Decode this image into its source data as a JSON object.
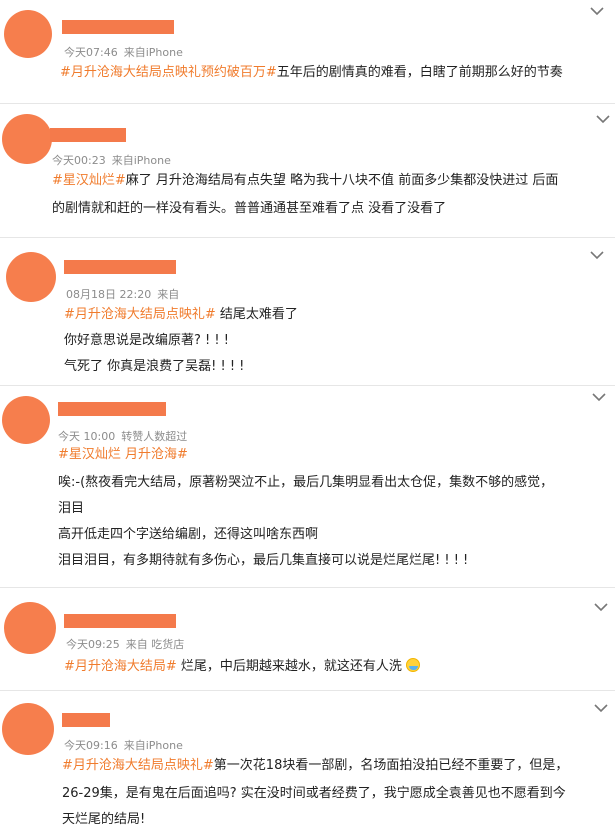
{
  "posts": [
    {
      "time": "今天07:46",
      "source": "来自iPhone",
      "tag1": "#月升沧海大结局点映礼预约破百万#",
      "lines": [
        "五年后的剧情真的难看，白瞎了前期那么好的节奏"
      ]
    },
    {
      "time": "今天00:23",
      "source": "来自iPhone",
      "tag1": "#星汉灿烂#",
      "lines": [
        "麻了 月升沧海结局有点失望 略为我十八块不值 前面多少集都没快进过 后面",
        "的剧情就和赶的一样没有看头。普普通通甚至难看了点 没看了没看了"
      ]
    },
    {
      "time": "08月18日 22:20",
      "source": "来自",
      "tag1": "#月升沧海大结局点映礼#",
      "lines": [
        " 结尾太难看了",
        "你好意思说是改编原著? ! ! !",
        "气死了 你真是浪费了吴磊! ! ! !"
      ]
    },
    {
      "time": "今天 10:00",
      "source": "转赞人数超过",
      "tag1": "#星汉灿烂 月升沧海#",
      "lines": [
        "唉:-(熬夜看完大结局，原著粉哭泣不止，最后几集明显看出太仓促，集数不够的感觉，",
        "泪目",
        "高开低走四个字送给编剧，还得这叫啥东西啊",
        "泪目泪目，有多期待就有多伤心，最后几集直接可以说是烂尾烂尾! ! ! !"
      ]
    },
    {
      "time": "今天09:25",
      "source": "来自 吃货店",
      "tag1": "#月升沧海大结局#",
      "lines": [
        " 烂尾，中后期越来越水，就这还有人洗"
      ],
      "emoji": "swimming-face"
    },
    {
      "time": "今天09:16",
      "source": "来自iPhone",
      "tag1": "#月升沧海大结局点映礼#",
      "lines": [
        "第一次花18块看一部剧，名场面拍没拍已经不重要了，但是，",
        "26-29集，是有鬼在后面追吗? 实在没时间或者经费了，我宁愿成全袁善见也不愿看到今",
        "天烂尾的结局!"
      ]
    }
  ],
  "colors": {
    "avatar": "#f67e4d",
    "tag": "#f07b2c",
    "meta": "#8c8c8c"
  },
  "icons": {
    "expand": "chevron-down-icon",
    "emoji": "swimming-face"
  }
}
